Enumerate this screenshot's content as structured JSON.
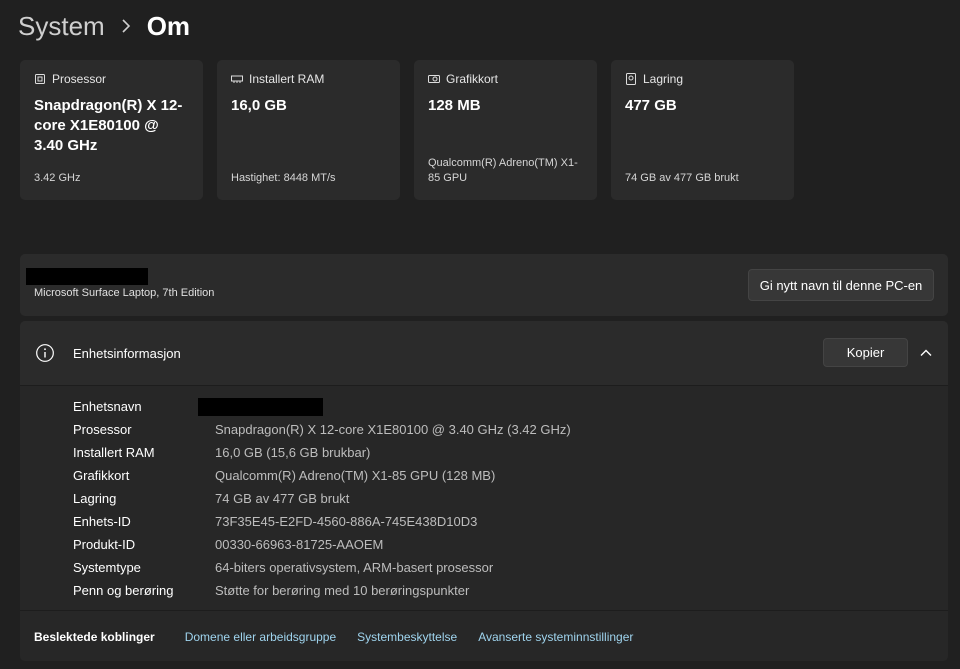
{
  "breadcrumb": {
    "parent": "System",
    "separator": "›",
    "current": "Om"
  },
  "cards": [
    {
      "icon": "processor-icon",
      "label": "Prosessor",
      "value": "Snapdragon(R) X 12-core X1E80100 @ 3.40 GHz",
      "sub": "3.42 GHz"
    },
    {
      "icon": "ram-icon",
      "label": "Installert RAM",
      "value": "16,0 GB",
      "sub": "Hastighet: 8448 MT/s"
    },
    {
      "icon": "gpu-icon",
      "label": "Grafikkort",
      "value": "128 MB",
      "sub": "Qualcomm(R) Adreno(TM) X1-85 GPU"
    },
    {
      "icon": "storage-icon",
      "label": "Lagring",
      "value": "477 GB",
      "sub": "74 GB av 477 GB brukt"
    }
  ],
  "device": {
    "model": "Microsoft Surface Laptop, 7th Edition",
    "rename_button": "Gi nytt navn til denne PC-en"
  },
  "device_info": {
    "title": "Enhetsinformasjon",
    "copy_button": "Kopier",
    "rows": [
      {
        "label": "Enhetsnavn",
        "value": ""
      },
      {
        "label": "Prosessor",
        "value": "Snapdragon(R) X 12-core X1E80100 @ 3.40 GHz (3.42 GHz)"
      },
      {
        "label": "Installert RAM",
        "value": "16,0 GB (15,6 GB brukbar)"
      },
      {
        "label": "Grafikkort",
        "value": "Qualcomm(R) Adreno(TM) X1-85 GPU (128 MB)"
      },
      {
        "label": "Lagring",
        "value": "74 GB av 477 GB brukt"
      },
      {
        "label": "Enhets-ID",
        "value": "73F35E45-E2FD-4560-886A-745E438D10D3"
      },
      {
        "label": "Produkt-ID",
        "value": "00330-66963-81725-AAOEM"
      },
      {
        "label": "Systemtype",
        "value": "64-biters operativsystem, ARM-basert prosessor"
      },
      {
        "label": "Penn og berøring",
        "value": "Støtte for berøring med 10 berøringspunkter"
      }
    ]
  },
  "related": {
    "title": "Beslektede koblinger",
    "links": [
      "Domene eller arbeidsgruppe",
      "Systembeskyttelse",
      "Avanserte systeminnstillinger"
    ]
  },
  "colors": {
    "background": "#202020",
    "card": "#2b2b2b",
    "link": "#9fd4ee",
    "value_text": "#bdbdbd"
  }
}
